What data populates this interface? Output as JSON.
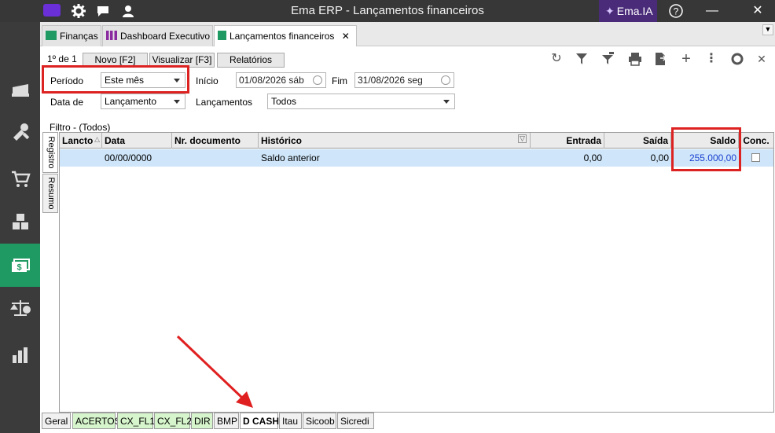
{
  "window": {
    "title": "Ema ERP - Lançamentos financeiros",
    "ai_button": "Ema.IA"
  },
  "tabs": [
    {
      "label": "Finanças",
      "icon": "money-icon"
    },
    {
      "label": "Dashboard Executivo",
      "icon": "bar-chart-icon"
    },
    {
      "label": "Lançamentos financeiros",
      "icon": "flag-icon",
      "active": true
    }
  ],
  "toolbar": {
    "page_count": "1º de 1",
    "novo": "Novo [F2]",
    "visualizar": "Visualizar [F3]",
    "relatorios": "Relatórios"
  },
  "filters": {
    "periodo_label": "Período",
    "periodo_value": "Este mês",
    "inicio_label": "Início",
    "inicio_value": "01/08/2026 sáb",
    "fim_label": "Fim",
    "fim_value": "31/08/2026 seg",
    "data_de_label": "Data de",
    "data_de_value": "Lançamento",
    "lancamentos_label": "Lançamentos",
    "lancamentos_value": "Todos",
    "filtro_text": "Filtro - (Todos)"
  },
  "side_tabs": [
    "Registro",
    "Resumo"
  ],
  "grid": {
    "columns": [
      "Lancto",
      "Data",
      "Nr. documento",
      "Histórico",
      "Entrada",
      "Saída",
      "Saldo",
      "Conc."
    ],
    "rows": [
      {
        "lancto": "",
        "data": "00/00/0000",
        "nr_documento": "",
        "historico": "Saldo anterior",
        "entrada": "0,00",
        "saida": "0,00",
        "saldo": "255.000,00",
        "conc": false
      }
    ]
  },
  "sheet_tabs": [
    {
      "label": "Geral",
      "color": "#f1f1f1"
    },
    {
      "label": "ACERTOS",
      "color": "#d6f5cc"
    },
    {
      "label": "CX_FL1",
      "color": "#d6f5cc"
    },
    {
      "label": "CX_FL2",
      "color": "#d6f5cc"
    },
    {
      "label": "DIR",
      "color": "#d6f5cc"
    },
    {
      "label": "BMP",
      "color": "#f1f1f1"
    },
    {
      "label": "D CASH",
      "color": "#ffffff",
      "active": true
    },
    {
      "label": "Itau",
      "color": "#f1f1f1"
    },
    {
      "label": "Sicoob",
      "color": "#f1f1f1"
    },
    {
      "label": "Sicredi",
      "color": "#f1f1f1"
    }
  ],
  "colors": {
    "accent_green": "#1f9a63",
    "highlight_red": "#d22222",
    "selected_row": "#cfe6fa",
    "saldo_text": "#1a3fd0"
  }
}
